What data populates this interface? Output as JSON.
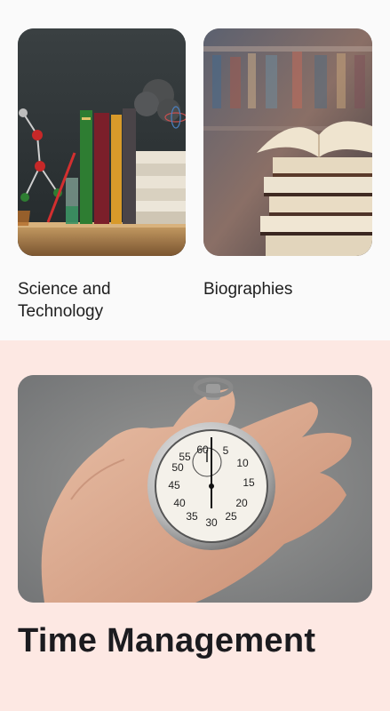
{
  "categories": [
    {
      "label": "Science and Technology",
      "image": "science-books-illustration"
    },
    {
      "label": "Biographies",
      "image": "stacked-books-illustration"
    }
  ],
  "featured": {
    "title": "Time Management",
    "image": "stopwatch-in-hand-illustration",
    "stopwatch_numbers": [
      "55",
      "60",
      "5",
      "10",
      "15",
      "20",
      "25",
      "30",
      "35",
      "40",
      "45",
      "50"
    ]
  },
  "colors": {
    "top_background": "#fafafa",
    "featured_background": "#fde8e3",
    "text": "#1e1e1e"
  }
}
